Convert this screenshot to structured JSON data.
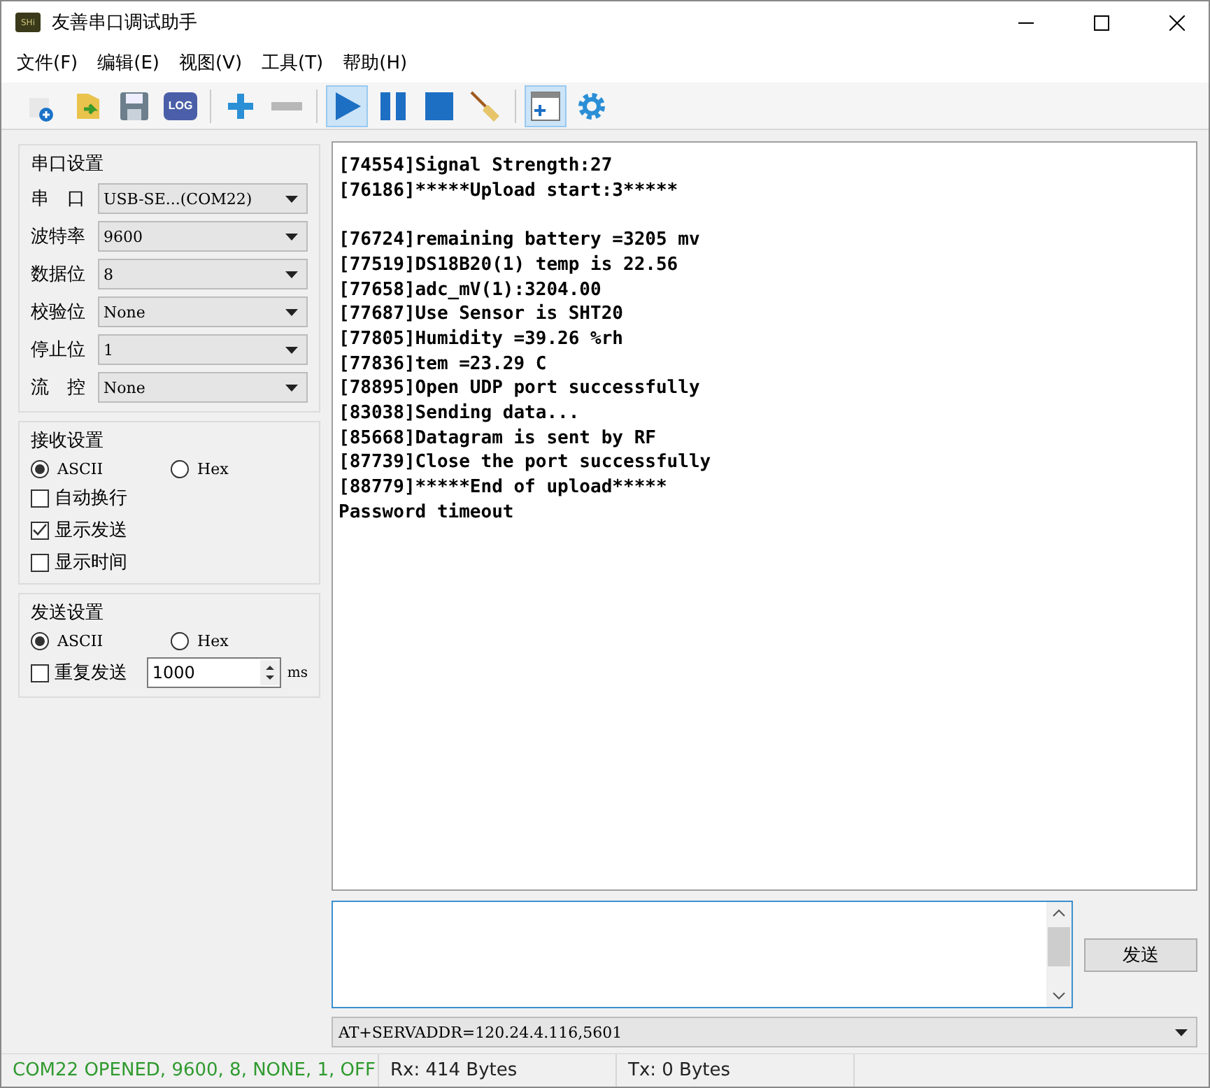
{
  "window": {
    "title": "友善串口调试助手",
    "app_icon_label": "SHi"
  },
  "menu": [
    "文件(F)",
    "编辑(E)",
    "视图(V)",
    "工具(T)",
    "帮助(H)"
  ],
  "toolbar": [
    {
      "kind": "new",
      "selected": false
    },
    {
      "kind": "open",
      "selected": false
    },
    {
      "kind": "save",
      "selected": false
    },
    {
      "kind": "log",
      "label": "LOG",
      "selected": false
    },
    {
      "kind": "sep"
    },
    {
      "kind": "add",
      "selected": false
    },
    {
      "kind": "remove",
      "selected": false
    },
    {
      "kind": "sep"
    },
    {
      "kind": "play",
      "selected": true
    },
    {
      "kind": "pause",
      "selected": false
    },
    {
      "kind": "stop",
      "selected": false
    },
    {
      "kind": "clear",
      "selected": false
    },
    {
      "kind": "sep"
    },
    {
      "kind": "window",
      "selected": true
    },
    {
      "kind": "settings",
      "selected": false
    }
  ],
  "serial_settings": {
    "title": "串口设置",
    "fields": [
      {
        "label": "串　口",
        "value": "USB-SE...(COM22)"
      },
      {
        "label": "波特率",
        "value": "9600"
      },
      {
        "label": "数据位",
        "value": "8"
      },
      {
        "label": "校验位",
        "value": "None"
      },
      {
        "label": "停止位",
        "value": "1"
      },
      {
        "label": "流　控",
        "value": "None"
      }
    ]
  },
  "receive_settings": {
    "title": "接收设置",
    "modes": [
      {
        "label": "ASCII",
        "selected": true
      },
      {
        "label": "Hex",
        "selected": false
      }
    ],
    "options": [
      {
        "label": "自动换行",
        "checked": false
      },
      {
        "label": "显示发送",
        "checked": true
      },
      {
        "label": "显示时间",
        "checked": false
      }
    ]
  },
  "send_settings": {
    "title": "发送设置",
    "modes": [
      {
        "label": "ASCII",
        "selected": true
      },
      {
        "label": "Hex",
        "selected": false
      }
    ],
    "repeat": {
      "label": "重复发送",
      "checked": false,
      "interval": "1000",
      "unit": "ms"
    }
  },
  "log_blocks": [
    [
      "[74554]Signal Strength:27",
      "[76186]*****Upload start:3*****"
    ],
    [
      "[76724]remaining battery =3205 mv",
      "[77519]DS18B20(1) temp is 22.56",
      "[77658]adc_mV(1):3204.00",
      "[77687]Use Sensor is SHT20",
      "[77805]Humidity =39.26 %rh",
      "[77836]tem =23.29 C",
      "[78895]Open UDP port successfully",
      "[83038]Sending data...",
      "[85668]Datagram is sent by RF",
      "[87739]Close the port successfully",
      "[88779]*****End of upload*****",
      "Password timeout"
    ]
  ],
  "send_button": "发送",
  "history_value": "AT+SERVADDR=120.24.4.116,5601",
  "status_bar": {
    "connection": "COM22 OPENED, 9600, 8, NONE, 1, OFF",
    "rx": "Rx: 414 Bytes",
    "tx": "Tx: 0 Bytes"
  }
}
